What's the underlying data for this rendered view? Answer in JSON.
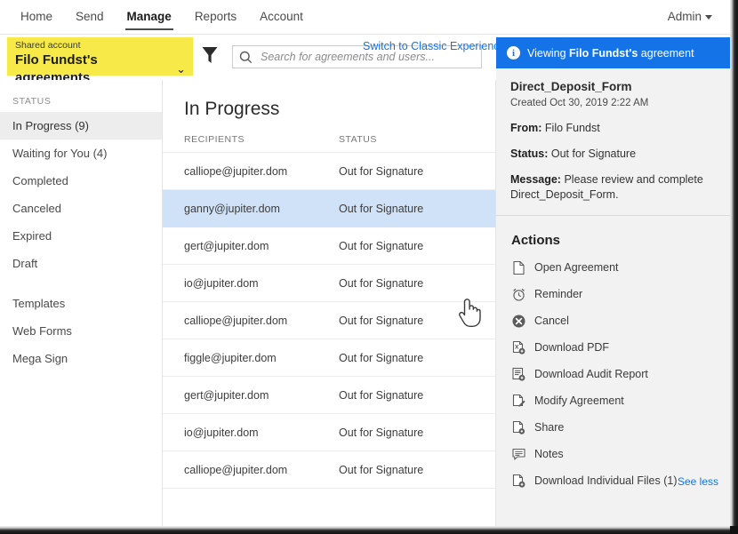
{
  "topnav": {
    "items": [
      {
        "label": "Home",
        "active": false
      },
      {
        "label": "Send",
        "active": false
      },
      {
        "label": "Manage",
        "active": true
      },
      {
        "label": "Reports",
        "active": false
      },
      {
        "label": "Account",
        "active": false
      }
    ],
    "admin_label": "Admin"
  },
  "subbar": {
    "shared_account_label": "Shared account",
    "shared_account_name": "Filo Fundst's agreements",
    "shared_caret": "⌄",
    "filter_icon": "filter-icon",
    "search_placeholder": "Search for agreements and users...",
    "search_value": "",
    "switch_classic": "Switch to Classic Experience"
  },
  "sidebar": {
    "heading": "STATUS",
    "items": [
      {
        "label": "In Progress (9)",
        "active": true
      },
      {
        "label": "Waiting for You (4)",
        "active": false
      },
      {
        "label": "Completed",
        "active": false
      },
      {
        "label": "Canceled",
        "active": false
      },
      {
        "label": "Expired",
        "active": false
      },
      {
        "label": "Draft",
        "active": false
      }
    ],
    "items2": [
      {
        "label": "Templates"
      },
      {
        "label": "Web Forms"
      },
      {
        "label": "Mega Sign"
      }
    ]
  },
  "main": {
    "title": "In Progress",
    "columns": {
      "recipients": "RECIPIENTS",
      "status": "STATUS"
    },
    "rows": [
      {
        "recipient": "calliope@jupiter.dom",
        "status": "Out for Signature",
        "selected": false
      },
      {
        "recipient": "ganny@jupiter.dom",
        "status": "Out for Signature",
        "selected": true
      },
      {
        "recipient": "gert@jupiter.dom",
        "status": "Out for Signature",
        "selected": false
      },
      {
        "recipient": "io@jupiter.dom",
        "status": "Out for Signature",
        "selected": false
      },
      {
        "recipient": "calliope@jupiter.dom",
        "status": "Out for Signature",
        "selected": false
      },
      {
        "recipient": "figgle@jupiter.dom",
        "status": "Out for Signature",
        "selected": false
      },
      {
        "recipient": "gert@jupiter.dom",
        "status": "Out for Signature",
        "selected": false
      },
      {
        "recipient": "io@jupiter.dom",
        "status": "Out for Signature",
        "selected": false
      },
      {
        "recipient": "calliope@jupiter.dom",
        "status": "Out for Signature",
        "selected": false
      }
    ]
  },
  "right": {
    "banner_prefix": "Viewing ",
    "banner_strong": "Filo Fundst's",
    "banner_suffix": " agreement",
    "doc_title": "Direct_Deposit_Form",
    "doc_created": "Created Oct 30, 2019 2:22 AM",
    "from_label": "From:",
    "from_value": "Filo Fundst",
    "status_label": "Status:",
    "status_value": "Out for Signature",
    "message_label": "Message:",
    "message_value": "Please review and complete Direct_Deposit_Form.",
    "actions_title": "Actions",
    "actions": [
      {
        "label": "Open Agreement",
        "icon": "document-icon"
      },
      {
        "label": "Reminder",
        "icon": "clock-icon"
      },
      {
        "label": "Cancel",
        "icon": "cancel-circle-icon"
      },
      {
        "label": "Download PDF",
        "icon": "pdf-download-icon"
      },
      {
        "label": "Download Audit Report",
        "icon": "audit-report-icon"
      },
      {
        "label": "Modify Agreement",
        "icon": "edit-document-icon"
      },
      {
        "label": "Share",
        "icon": "share-document-icon"
      },
      {
        "label": "Notes",
        "icon": "notes-icon"
      },
      {
        "label": "Download Individual Files (1)",
        "icon": "file-download-icon"
      }
    ],
    "see_less": "See less"
  },
  "colors": {
    "accent_blue": "#1473e6",
    "shared_yellow": "#f7ea48",
    "selected_row": "#cfe2f7",
    "annotation_red": "#f4362f",
    "panel_grey": "#f2f2f2"
  }
}
